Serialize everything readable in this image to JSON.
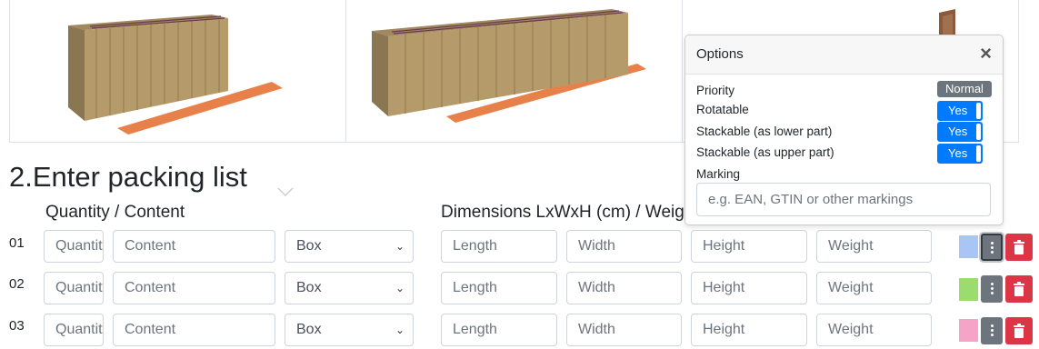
{
  "section": {
    "title": "2.Enter packing list"
  },
  "columns": {
    "quantity_content": "Quantity / Content",
    "dimensions": "Dimensions LxWxH (cm) / Weight"
  },
  "placeholders": {
    "quantity": "Quantity",
    "content": "Content",
    "length": "Length",
    "width": "Width",
    "height": "Height",
    "weight": "Weight"
  },
  "rows": [
    {
      "num": "01",
      "type": "Box",
      "color": "#a9c5f5"
    },
    {
      "num": "02",
      "type": "Box",
      "color": "#9bdc6e"
    },
    {
      "num": "03",
      "type": "Box",
      "color": "#f5a3c7"
    }
  ],
  "popover": {
    "title": "Options",
    "close": "×",
    "priority_label": "Priority",
    "priority_value": "Normal",
    "rotatable_label": "Rotatable",
    "rotatable_value": "Yes",
    "stack_lower_label": "Stackable (as lower part)",
    "stack_lower_value": "Yes",
    "stack_upper_label": "Stackable (as upper part)",
    "stack_upper_value": "Yes",
    "marking_label": "Marking",
    "marking_placeholder": "e.g. EAN, GTIN or other markings"
  },
  "colors": {
    "accent": "#007bff",
    "danger": "#dc3545",
    "secondary": "#6c757d"
  }
}
